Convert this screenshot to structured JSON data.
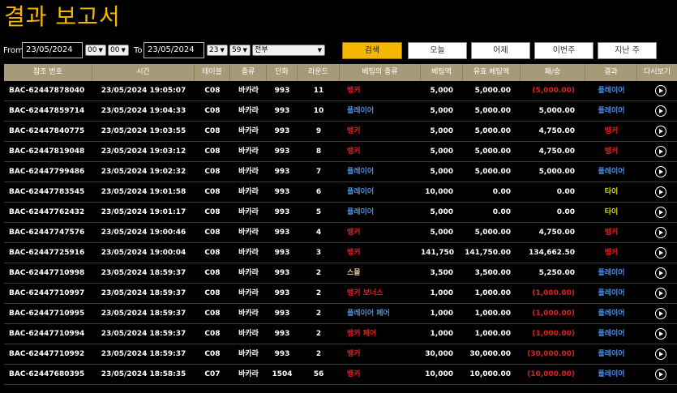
{
  "page": {
    "title": "결과 보고서"
  },
  "filters": {
    "from_label": "From",
    "from_date": "23/05/2024",
    "from_hour": "00",
    "from_minute": "00",
    "to_label": "To",
    "to_date": "23/05/2024",
    "to_hour": "23",
    "to_minute": "59",
    "type_value": "전부"
  },
  "buttons": {
    "search": "검색",
    "today": "오늘",
    "yesterday": "어제",
    "this_week": "이번주",
    "last_week": "지난 주"
  },
  "table": {
    "headers": [
      "참조 번호",
      "시간",
      "테이블",
      "종류",
      "단화",
      "라운드",
      "베팅의 종류",
      "베팅액",
      "유효 베팅액",
      "패/승",
      "결과",
      "다시보기"
    ],
    "rows": [
      {
        "ref": "BAC-62447878040",
        "time": "23/05/2024 19:05:07",
        "table": "C08",
        "kind": "바카라",
        "unit": "993",
        "round": "11",
        "bet_type": "뱅커",
        "bet_type_color": "red",
        "bet": "5,000",
        "valid": "5,000.00",
        "winloss": "(5,000.00)",
        "winloss_color": "red",
        "result": "플레이어",
        "result_color": "blue"
      },
      {
        "ref": "BAC-62447859714",
        "time": "23/05/2024 19:04:33",
        "table": "C08",
        "kind": "바카라",
        "unit": "993",
        "round": "10",
        "bet_type": "플레이어",
        "bet_type_color": "blue",
        "bet": "5,000",
        "valid": "5,000.00",
        "winloss": "5,000.00",
        "winloss_color": "white",
        "result": "플레이어",
        "result_color": "blue"
      },
      {
        "ref": "BAC-62447840775",
        "time": "23/05/2024 19:03:55",
        "table": "C08",
        "kind": "바카라",
        "unit": "993",
        "round": "9",
        "bet_type": "뱅커",
        "bet_type_color": "red",
        "bet": "5,000",
        "valid": "5,000.00",
        "winloss": "4,750.00",
        "winloss_color": "white",
        "result": "뱅커",
        "result_color": "red"
      },
      {
        "ref": "BAC-62447819048",
        "time": "23/05/2024 19:03:12",
        "table": "C08",
        "kind": "바카라",
        "unit": "993",
        "round": "8",
        "bet_type": "뱅커",
        "bet_type_color": "red",
        "bet": "5,000",
        "valid": "5,000.00",
        "winloss": "4,750.00",
        "winloss_color": "white",
        "result": "뱅커",
        "result_color": "red"
      },
      {
        "ref": "BAC-62447799486",
        "time": "23/05/2024 19:02:32",
        "table": "C08",
        "kind": "바카라",
        "unit": "993",
        "round": "7",
        "bet_type": "플레이어",
        "bet_type_color": "blue",
        "bet": "5,000",
        "valid": "5,000.00",
        "winloss": "5,000.00",
        "winloss_color": "white",
        "result": "플레이어",
        "result_color": "blue"
      },
      {
        "ref": "BAC-62447783545",
        "time": "23/05/2024 19:01:58",
        "table": "C08",
        "kind": "바카라",
        "unit": "993",
        "round": "6",
        "bet_type": "플레이어",
        "bet_type_color": "blue",
        "bet": "10,000",
        "valid": "0.00",
        "winloss": "0.00",
        "winloss_color": "white",
        "result": "타이",
        "result_color": "yellow"
      },
      {
        "ref": "BAC-62447762432",
        "time": "23/05/2024 19:01:17",
        "table": "C08",
        "kind": "바카라",
        "unit": "993",
        "round": "5",
        "bet_type": "플레이어",
        "bet_type_color": "blue",
        "bet": "5,000",
        "valid": "0.00",
        "winloss": "0.00",
        "winloss_color": "white",
        "result": "타이",
        "result_color": "yellow"
      },
      {
        "ref": "BAC-62447747576",
        "time": "23/05/2024 19:00:46",
        "table": "C08",
        "kind": "바카라",
        "unit": "993",
        "round": "4",
        "bet_type": "뱅커",
        "bet_type_color": "red",
        "bet": "5,000",
        "valid": "5,000.00",
        "winloss": "4,750.00",
        "winloss_color": "white",
        "result": "뱅커",
        "result_color": "red"
      },
      {
        "ref": "BAC-62447725916",
        "time": "23/05/2024 19:00:04",
        "table": "C08",
        "kind": "바카라",
        "unit": "993",
        "round": "3",
        "bet_type": "뱅커",
        "bet_type_color": "red",
        "bet": "141,750",
        "valid": "141,750.00",
        "winloss": "134,662.50",
        "winloss_color": "white",
        "result": "뱅커",
        "result_color": "red"
      },
      {
        "ref": "BAC-62447710998",
        "time": "23/05/2024 18:59:37",
        "table": "C08",
        "kind": "바카라",
        "unit": "993",
        "round": "2",
        "bet_type": "스몰",
        "bet_type_color": "tan",
        "bet": "3,500",
        "valid": "3,500.00",
        "winloss": "5,250.00",
        "winloss_color": "white",
        "result": "플레이어",
        "result_color": "blue"
      },
      {
        "ref": "BAC-62447710997",
        "time": "23/05/2024 18:59:37",
        "table": "C08",
        "kind": "바카라",
        "unit": "993",
        "round": "2",
        "bet_type": "뱅커 보너스",
        "bet_type_color": "red",
        "bet": "1,000",
        "valid": "1,000.00",
        "winloss": "(1,000.00)",
        "winloss_color": "red",
        "result": "플레이어",
        "result_color": "blue"
      },
      {
        "ref": "BAC-62447710995",
        "time": "23/05/2024 18:59:37",
        "table": "C08",
        "kind": "바카라",
        "unit": "993",
        "round": "2",
        "bet_type": "플레이어 페어",
        "bet_type_color": "blue",
        "bet": "1,000",
        "valid": "1,000.00",
        "winloss": "(1,000.00)",
        "winloss_color": "red",
        "result": "플레이어",
        "result_color": "blue"
      },
      {
        "ref": "BAC-62447710994",
        "time": "23/05/2024 18:59:37",
        "table": "C08",
        "kind": "바카라",
        "unit": "993",
        "round": "2",
        "bet_type": "뱅커 페어",
        "bet_type_color": "red",
        "bet": "1,000",
        "valid": "1,000.00",
        "winloss": "(1,000.00)",
        "winloss_color": "red",
        "result": "플레이어",
        "result_color": "blue"
      },
      {
        "ref": "BAC-62447710992",
        "time": "23/05/2024 18:59:37",
        "table": "C08",
        "kind": "바카라",
        "unit": "993",
        "round": "2",
        "bet_type": "뱅커",
        "bet_type_color": "red",
        "bet": "30,000",
        "valid": "30,000.00",
        "winloss": "(30,000.00)",
        "winloss_color": "red",
        "result": "플레이어",
        "result_color": "blue"
      },
      {
        "ref": "BAC-62447680395",
        "time": "23/05/2024 18:58:35",
        "table": "C07",
        "kind": "바카라",
        "unit": "1504",
        "round": "56",
        "bet_type": "뱅커",
        "bet_type_color": "red",
        "bet": "10,000",
        "valid": "10,000.00",
        "winloss": "(10,000.00)",
        "winloss_color": "red",
        "result": "플레이어",
        "result_color": "blue"
      }
    ]
  },
  "colors": {
    "accent": "#f5b800",
    "header_bg": "#a69a78",
    "red": "#e02020",
    "blue": "#4a8ee8",
    "yellow": "#d8d820",
    "tan": "#e8c9a0"
  }
}
